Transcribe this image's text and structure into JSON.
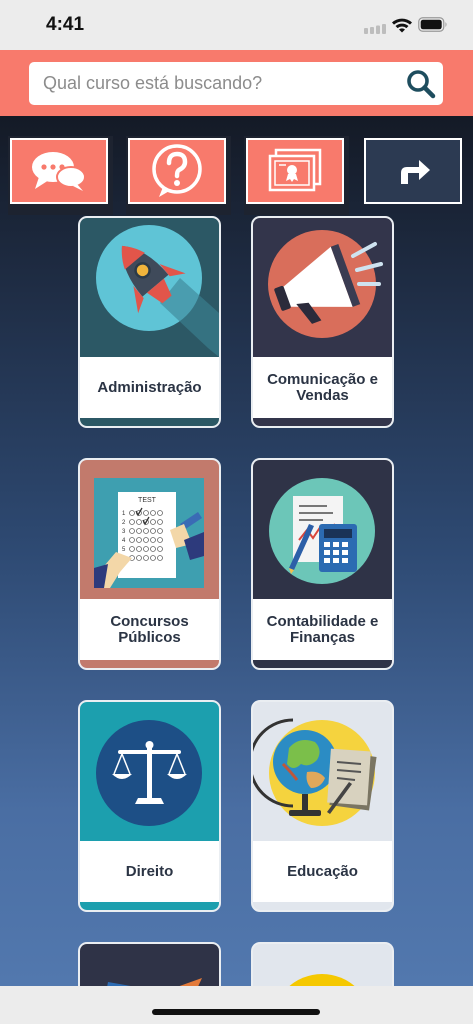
{
  "status_bar": {
    "time": "4:41"
  },
  "search": {
    "placeholder": "Qual curso está buscando?",
    "value": ""
  },
  "toolbar": {
    "buttons": [
      {
        "icon": "chat-bubbles-icon",
        "color": "#f87a6c"
      },
      {
        "icon": "question-icon",
        "color": "#f87a6c"
      },
      {
        "icon": "certificate-icon",
        "color": "#f87a6c"
      },
      {
        "icon": "share-arrow-icon",
        "color": "#2c3a52"
      }
    ]
  },
  "categories": [
    {
      "label": "Administração",
      "art_bg": "#2c5865",
      "circle": "#5fc4d6",
      "strip": "#2c5865"
    },
    {
      "label": "Comunicação e Vendas",
      "art_bg": "#33354b",
      "circle": "#d96e5b",
      "strip": "#33354b"
    },
    {
      "label": "Concursos Públicos",
      "art_bg": "#c27a6c",
      "circle": "#3e9fb0",
      "strip": "#c27a6c"
    },
    {
      "label": "Contabilidade e Finanças",
      "art_bg": "#2f3347",
      "circle": "#6cc6b8",
      "strip": "#2f3347"
    },
    {
      "label": "Direito",
      "art_bg": "#1c9fae",
      "circle": "#1d4f86",
      "strip": "#1c9fae"
    },
    {
      "label": "Educação",
      "art_bg": "#e1e6ed",
      "circle": "#f5d33e",
      "strip": "#e1e6ed"
    }
  ],
  "colors": {
    "accent": "#f87a6c",
    "navy": "#2c3a52"
  }
}
